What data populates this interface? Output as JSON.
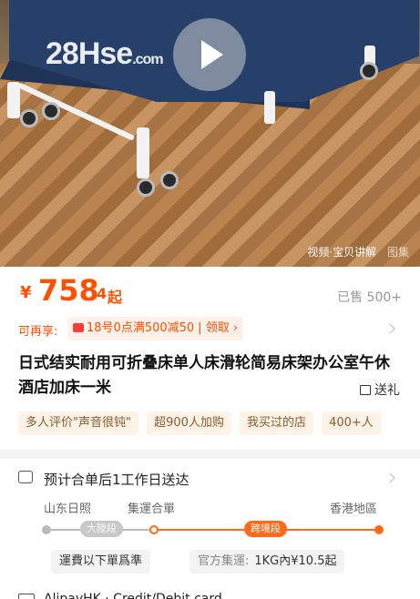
{
  "hero": {
    "watermark_main": "28Hse",
    "watermark_suffix": ".com",
    "media_tabs": [
      "视频·宝贝讲解",
      "图集"
    ]
  },
  "price": {
    "currency": "¥",
    "integer": "758",
    "decimal": ".4",
    "suffix": "起",
    "sold": "已售 500+"
  },
  "coupon": {
    "lead": "可再享:",
    "text": "18号0点满500减50",
    "action": "领取",
    "action_arrow": "›"
  },
  "product": {
    "title": "日式结实耐用可折叠床单人床滑轮简易床架办公室午休酒店加床一米",
    "gift": "送礼"
  },
  "tags": [
    "多人评价\"声音很钝\"",
    "超900人加购",
    "我买过的店",
    "400+人"
  ],
  "shipping": {
    "estimate": "预计合单后1工作日送达",
    "origin": "山东日照",
    "hub": "集運合單",
    "destination": "香港地區",
    "stage1": "大陸段",
    "stage2": "跨境段",
    "fee_note": "運費以下單爲準",
    "official_label": "官方集運:",
    "official_price": "1KG內¥10.5起"
  },
  "payment": {
    "text": "AlipayHK · Credit/Debit card"
  },
  "colors": {
    "accent": "#ff5000",
    "route_orange": "#ff6a1a",
    "tag_bg": "#fff3e8"
  }
}
